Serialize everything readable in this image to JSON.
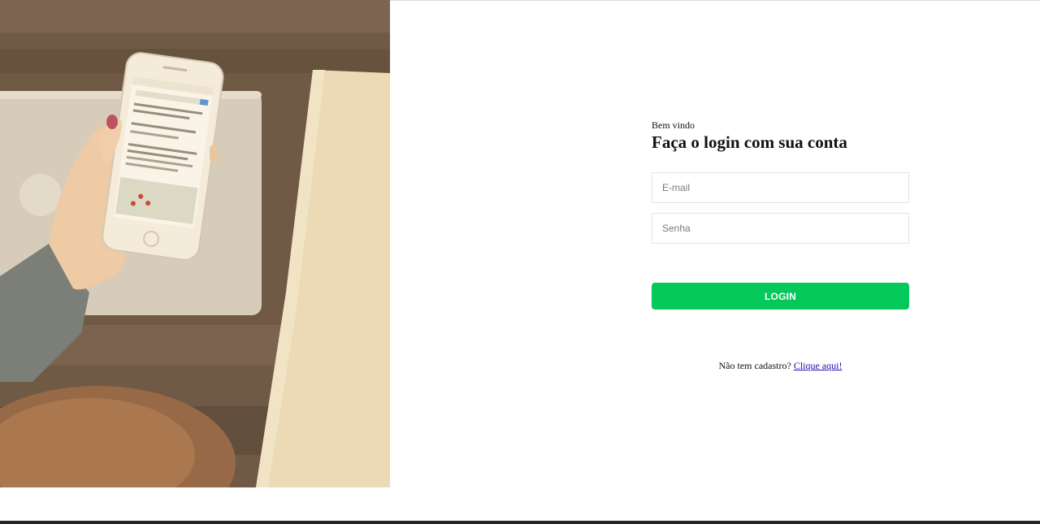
{
  "login": {
    "greeting": "Bem vindo",
    "title": "Faça o login com sua conta",
    "email_placeholder": "E-mail",
    "password_placeholder": "Senha",
    "button_label": "LOGIN",
    "signup_text": "Não tem cadastro?",
    "signup_link": "Clique aqui!"
  },
  "colors": {
    "button": "#05c85b",
    "link": "#1a0dab"
  }
}
